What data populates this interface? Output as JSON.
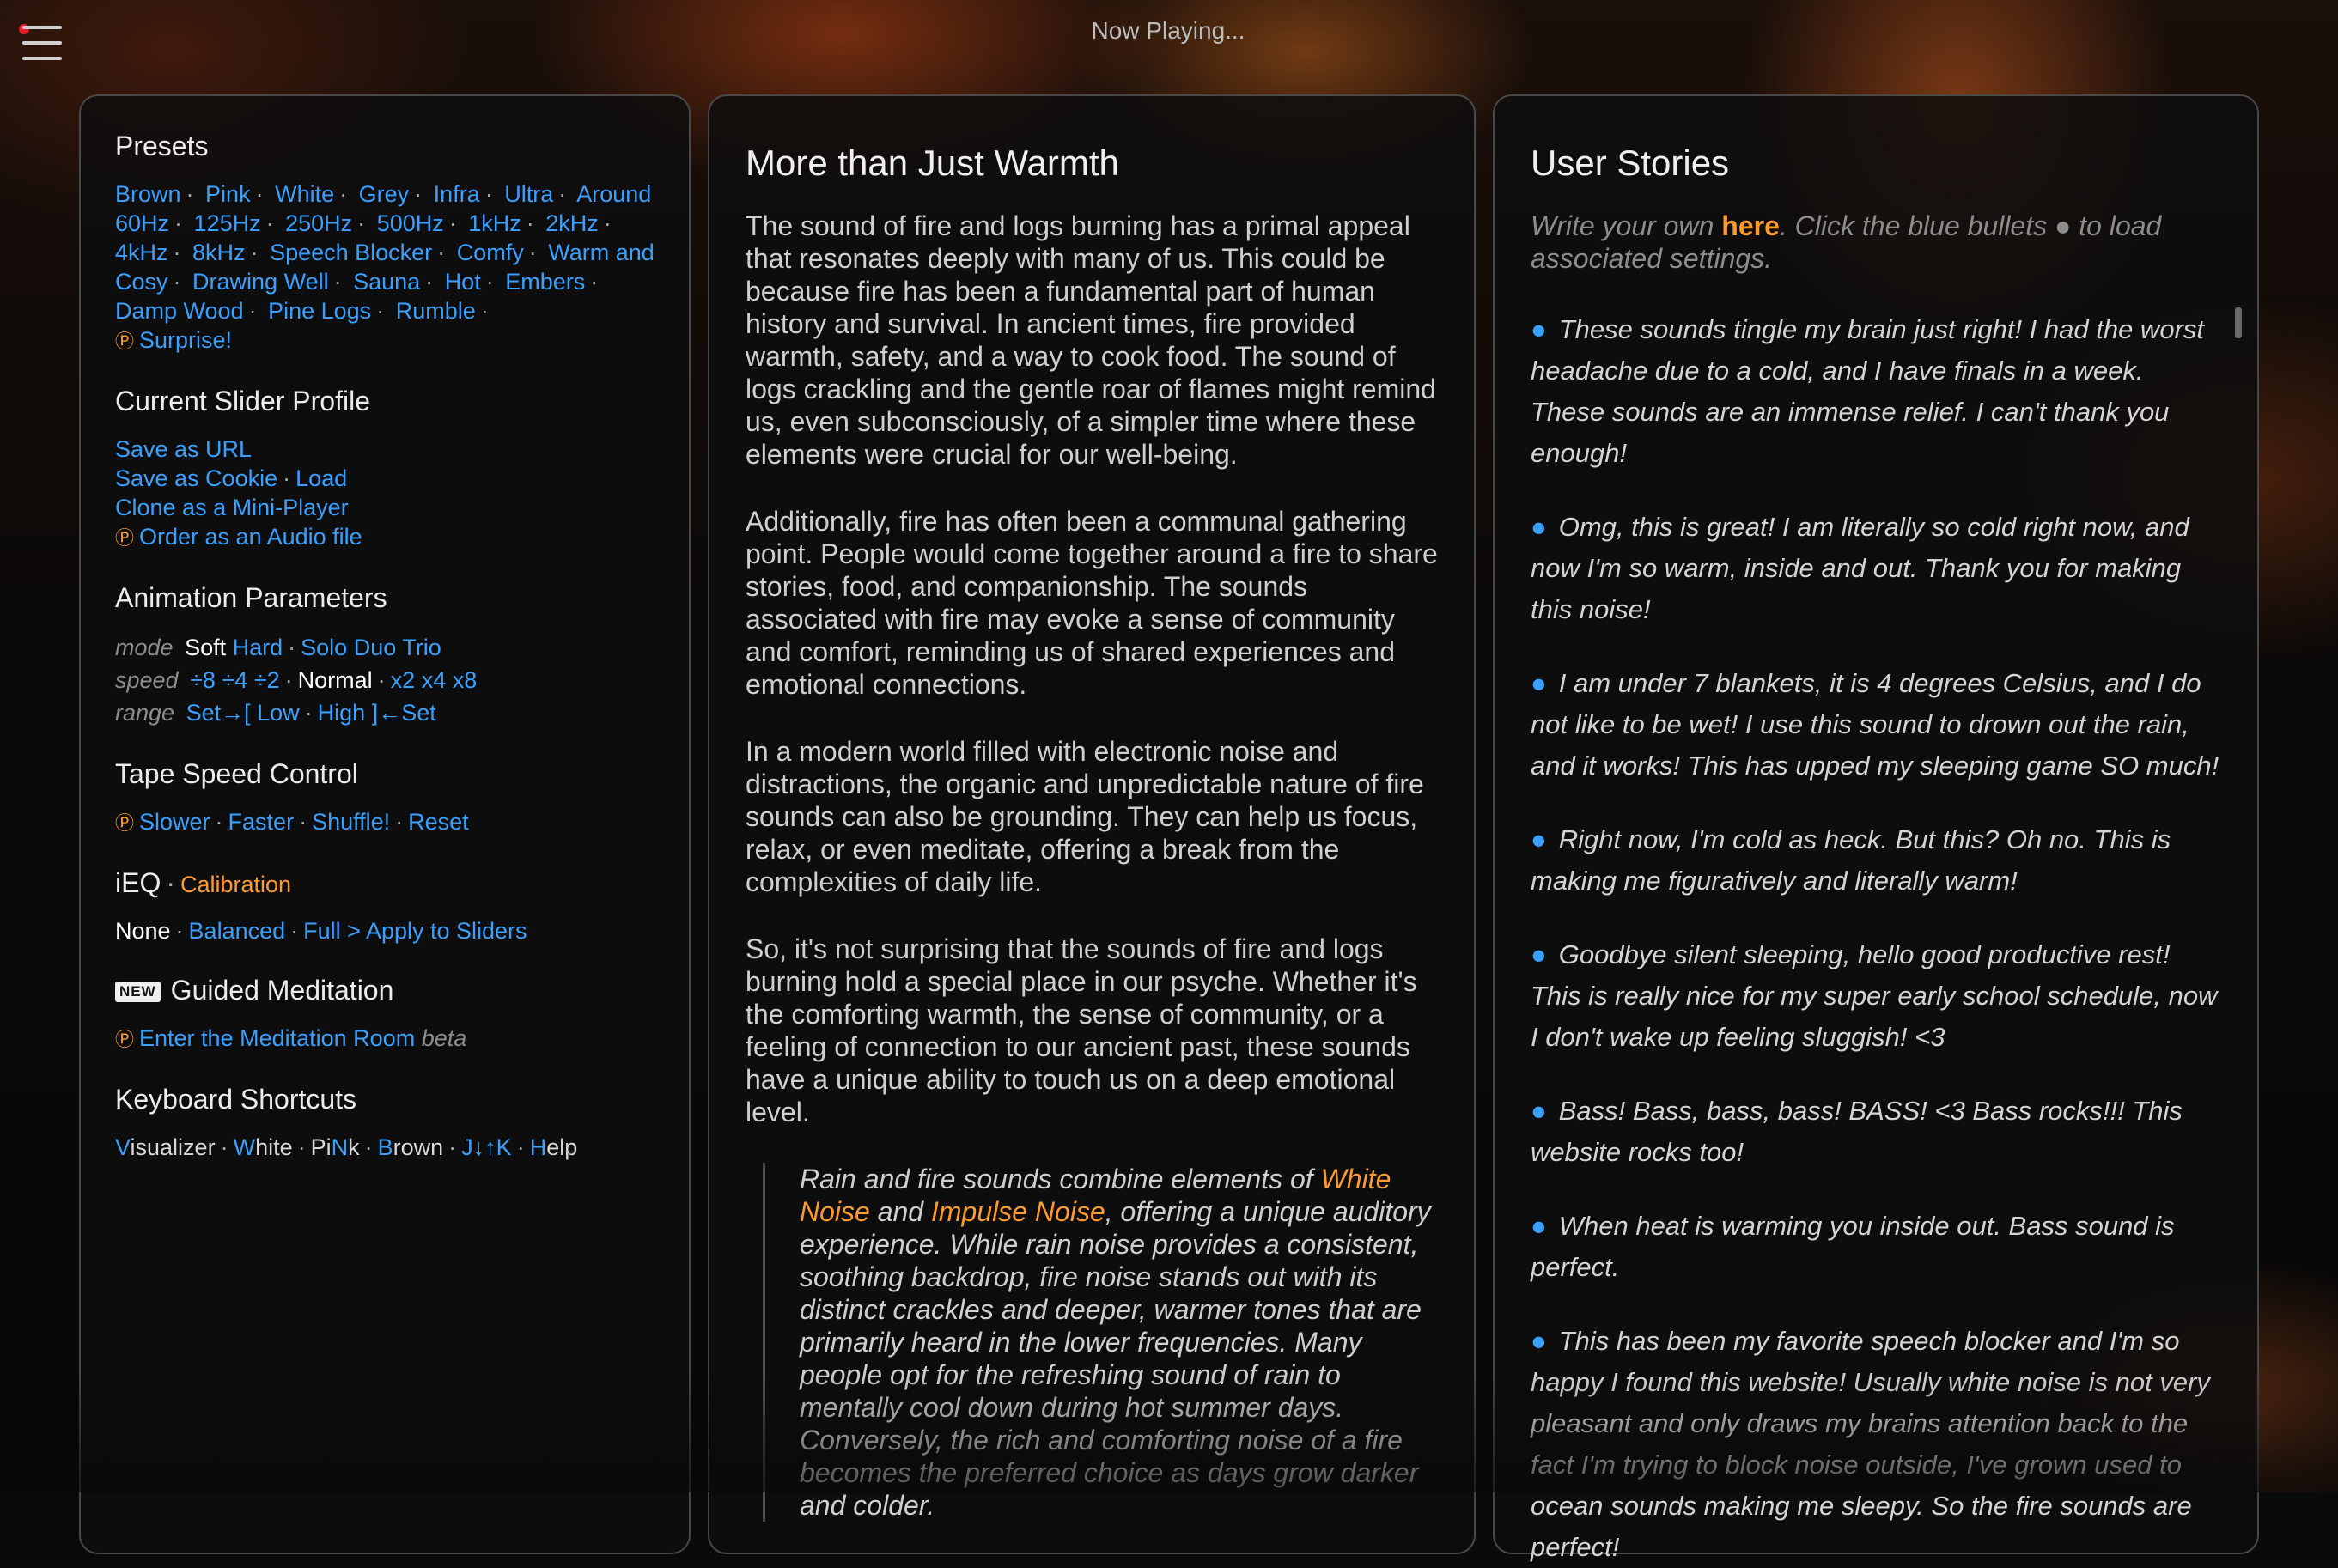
{
  "header": {
    "now_playing": "Now Playing..."
  },
  "colors": {
    "link": "#3aa0ff",
    "accent": "#ff9a2c",
    "menu_dot": "#e0202a"
  },
  "left": {
    "presets": {
      "title": "Presets",
      "items": [
        "Brown",
        "Pink",
        "White",
        "Grey",
        "Infra",
        "Ultra",
        "Around 60Hz",
        "125Hz",
        "250Hz",
        "500Hz",
        "1kHz",
        "2kHz",
        "4kHz",
        "8kHz",
        "Speech Blocker",
        "Comfy",
        "Warm and Cosy",
        "Drawing Well",
        "Sauna",
        "Hot",
        "Embers",
        "Damp Wood",
        "Pine Logs",
        "Rumble"
      ],
      "surprise": "Surprise!"
    },
    "profile": {
      "title": "Current Slider Profile",
      "save_url": "Save as URL",
      "save_cookie": "Save as Cookie",
      "load": "Load",
      "clone": "Clone as a Mini-Player",
      "order": "Order as an Audio file"
    },
    "animation": {
      "title": "Animation Parameters",
      "mode_label": "mode",
      "mode_soft": "Soft",
      "mode_hard": "Hard",
      "mode_solo": "Solo",
      "mode_duo": "Duo",
      "mode_trio": "Trio",
      "speed_label": "speed",
      "speed_div8": "÷8",
      "speed_div4": "÷4",
      "speed_div2": "÷2",
      "speed_normal": "Normal",
      "speed_x2": "x2",
      "speed_x4": "x4",
      "speed_x8": "x8",
      "range_label": "range",
      "range_set_low": "Set→[",
      "range_low": "Low",
      "range_high": "High",
      "range_set_high": "]←Set"
    },
    "tape": {
      "title": "Tape Speed Control",
      "slower": "Slower",
      "faster": "Faster",
      "shuffle": "Shuffle!",
      "reset": "Reset"
    },
    "ieq": {
      "title": "iEQ",
      "calibration": "Calibration",
      "none": "None",
      "balanced": "Balanced",
      "full": "Full",
      "apply": "> Apply to Sliders"
    },
    "guided": {
      "badge": "NEW",
      "title": "Guided Meditation",
      "enter": "Enter the Meditation Room",
      "beta": "beta"
    },
    "keyboard": {
      "title": "Keyboard Shortcuts",
      "visualizer_key": "V",
      "visualizer_rest": "isualizer",
      "white_key": "W",
      "white_rest": "hite",
      "pink_pre": "Pi",
      "pink_key": "N",
      "pink_rest": "k",
      "brown_key": "B",
      "brown_rest": "rown",
      "updown_keys": "J↓↑K",
      "help_key": "H",
      "help_rest": "elp"
    },
    "coin_icon": "Ⓟ"
  },
  "middle": {
    "title": "More than Just Warmth",
    "paragraphs": [
      "The sound of fire and logs burning has a primal appeal that resonates deeply with many of us. This could be because fire has been a fundamental part of human history and survival. In ancient times, fire provided warmth, safety, and a way to cook food. The sound of logs crackling and the gentle roar of flames might remind us, even subconsciously, of a simpler time where these elements were crucial for our well-being.",
      "Additionally, fire has often been a communal gathering point. People would come together around a fire to share stories, food, and companionship. The sounds associated with fire may evoke a sense of community and comfort, reminding us of shared experiences and emotional connections.",
      "In a modern world filled with electronic noise and distractions, the organic and unpredictable nature of fire sounds can also be grounding. They can help us focus, relax, or even meditate, offering a break from the complexities of daily life.",
      "So, it's not surprising that the sounds of fire and logs burning hold a special place in our psyche. Whether it's the comforting warmth, the sense of community, or a feeling of connection to our ancient past, these sounds have a unique ability to touch us on a deep emotional level."
    ],
    "quote": {
      "part1": "Rain and fire sounds combine elements of ",
      "link1": "White Noise",
      "part2": " and ",
      "link2": "Impulse Noise",
      "part3": ", offering a unique auditory experience. While rain noise provides a consistent, soothing backdrop, fire noise stands out with its distinct crackles and deeper, warmer tones that are primarily heard in the lower frequencies. Many people opt for the refreshing sound of rain to mentally cool down during hot summer days. Conversely, the rich and comforting noise of a fire becomes the preferred choice as days grow darker and colder."
    }
  },
  "right": {
    "title": "User Stories",
    "intro_part1": "Write your own ",
    "intro_link": "here",
    "intro_part2": ". Click the blue bullets ● to load associated settings.",
    "bullet": "●",
    "stories": [
      "These sounds tingle my brain just right! I had the worst headache due to a cold, and I have finals in a week. These sounds are an immense relief. I can't thank you enough!",
      "Omg, this is great! I am literally so cold right now, and now I'm so warm, inside and out. Thank you for making this noise!",
      "I am under 7 blankets, it is 4 degrees Celsius, and I do not like to be wet! I use this sound to drown out the rain, and it works! This has upped my sleeping game SO much!",
      "Right now, I'm cold as heck. But this? Oh no. This is making me figuratively and literally warm!",
      "Goodbye silent sleeping, hello good productive rest! This is really nice for my super early school schedule, now I don't wake up feeling sluggish! <3",
      "Bass! Bass, bass, bass! BASS! <3 Bass rocks!!! This website rocks too!",
      "When heat is warming you inside out. Bass sound is perfect.",
      "This has been my favorite speech blocker and I'm so happy I found this website! Usually white noise is not very pleasant and only draws my brains attention back to the fact I'm trying to block noise outside, I've grown used to ocean sounds making me sleepy. So the fire sounds are perfect!"
    ]
  }
}
